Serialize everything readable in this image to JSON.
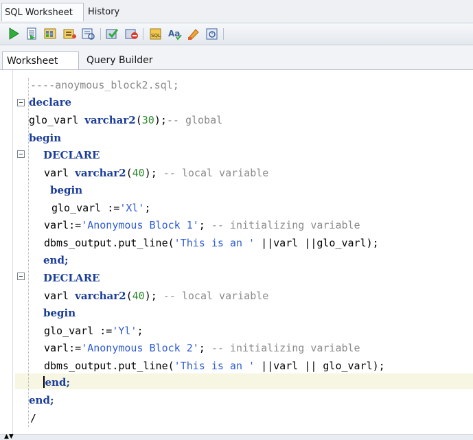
{
  "top_tabs": [
    "SQL Worksheet",
    "History"
  ],
  "sub_tabs": [
    "Worksheet",
    "Query Builder"
  ],
  "toolbar": {
    "icons": [
      "run-statement-icon",
      "run-script-icon",
      "autotrace-icon",
      "explain-plan-icon",
      "sql-tuning-advisor-icon",
      "commit-icon",
      "rollback-icon",
      "unshared-sql-worksheet-icon",
      "to-upper-lower-icon",
      "clear-icon",
      "sql-history-icon"
    ]
  },
  "code": {
    "l1": "----anoymous_block2.sql;",
    "l2_kw": "declare",
    "l3_a": "glo_varl ",
    "l3_kw": "varchar2",
    "l3_b": "(",
    "l3_num": "30",
    "l3_c": ");",
    "l3_cm": "-- global",
    "l4_kw": "begin",
    "l5_kw": "DECLARE",
    "l6_a": "varl ",
    "l6_kw": "varchar2",
    "l6_b": "(",
    "l6_num": "40",
    "l6_c": "); ",
    "l6_cm": "-- local variable",
    "l7_kw": "begin",
    "l8_a": "glo_varl :=",
    "l8_st": "'Xl'",
    "l8_b": ";",
    "l9_a": "varl:=",
    "l9_st": "'Anonymous Block 1'",
    "l9_b": "; ",
    "l9_cm": "-- initializing variable",
    "l10_a": "dbms_output.put_line(",
    "l10_st": "'This is an '",
    "l10_b": " ||varl ||glo_varl);",
    "l11_kw": "end;",
    "l12_kw": "DECLARE",
    "l13_a": "varl ",
    "l13_kw": "varchar2",
    "l13_b": "(",
    "l13_num": "40",
    "l13_c": "); ",
    "l13_cm": "-- local variable",
    "l14_kw": "begin",
    "l15_a": "glo_varl :=",
    "l15_st": "'Yl'",
    "l15_b": ";",
    "l16_a": "varl:=",
    "l16_st": "'Anonymous Block 2'",
    "l16_b": "; ",
    "l16_cm": "-- initializing variable",
    "l17_a": "dbms_output.put_line(",
    "l17_st": "'This is an '",
    "l17_b": " ||varl || glo_varl);",
    "l18_kw": "end;",
    "l19_kw": "end;",
    "l20": "/"
  },
  "colors": {
    "keyword": "#1a3d99",
    "comment": "#8a8a8a",
    "string": "#2d5bd1",
    "number": "#2c8a2c",
    "current_line": "#f6f6e3"
  }
}
